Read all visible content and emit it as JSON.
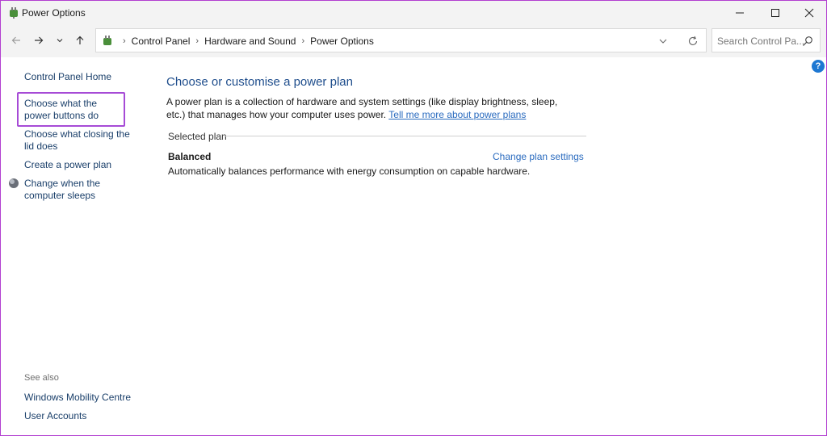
{
  "window": {
    "title": "Power Options"
  },
  "address": {
    "crumbs": [
      "Control Panel",
      "Hardware and Sound",
      "Power Options"
    ],
    "search_placeholder": "Search Control Pa..."
  },
  "sidebar": {
    "home": "Control Panel Home",
    "items": [
      "Choose what the power buttons do",
      "Choose what closing the lid does",
      "Create a power plan",
      "Change when the computer sleeps"
    ],
    "see_also_label": "See also",
    "see_also": [
      "Windows Mobility Centre",
      "User Accounts"
    ]
  },
  "main": {
    "heading": "Choose or customise a power plan",
    "description": "A power plan is a collection of hardware and system settings (like display brightness, sleep, etc.) that manages how your computer uses power.",
    "more_link": "Tell me more about power plans",
    "selected_label": "Selected plan",
    "plan": {
      "name": "Balanced",
      "settings_link": "Change plan settings",
      "description": "Automatically balances performance with energy consumption on capable hardware."
    }
  },
  "colors": {
    "highlight": "#a64bd6",
    "link": "#2a6bbf",
    "heading": "#1e4d8c"
  }
}
